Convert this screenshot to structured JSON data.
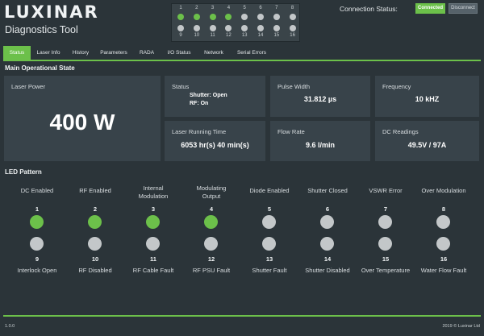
{
  "header": {
    "logo": "LUXINAR",
    "subtitle": "Diagnostics Tool",
    "connection_label": "Connection Status:",
    "connection_status": "Connected",
    "disconnect_label": "Disconnect"
  },
  "mini_leds": [
    {
      "n": "1",
      "state": "on"
    },
    {
      "n": "2",
      "state": "on"
    },
    {
      "n": "3",
      "state": "on"
    },
    {
      "n": "4",
      "state": "on"
    },
    {
      "n": "5",
      "state": "off"
    },
    {
      "n": "6",
      "state": "off"
    },
    {
      "n": "7",
      "state": "off"
    },
    {
      "n": "8",
      "state": "off"
    },
    {
      "n": "9",
      "state": "off"
    },
    {
      "n": "10",
      "state": "off"
    },
    {
      "n": "11",
      "state": "off"
    },
    {
      "n": "12",
      "state": "off"
    },
    {
      "n": "13",
      "state": "off"
    },
    {
      "n": "14",
      "state": "off"
    },
    {
      "n": "15",
      "state": "off"
    },
    {
      "n": "16",
      "state": "off"
    }
  ],
  "tabs": [
    "Status",
    "Laser Info",
    "History",
    "Parameters",
    "RADA",
    "I/O Status",
    "Network",
    "Serial Errors"
  ],
  "active_tab": "Status",
  "main": {
    "title": "Main Operational State",
    "laser_power": {
      "label": "Laser Power",
      "value": "400 W"
    },
    "status": {
      "label": "Status",
      "line1": "Shutter: Open",
      "line2": "RF: On"
    },
    "pulse_width": {
      "label": "Pulse Width",
      "value": "31.812 µs"
    },
    "frequency": {
      "label": "Frequency",
      "value": "10 kHZ"
    },
    "running_time": {
      "label": "Laser Running Time",
      "value": "6053 hr(s) 40 min(s)"
    },
    "flow_rate": {
      "label": "Flow Rate",
      "value": "9.6 l/min"
    },
    "dc_readings": {
      "label": "DC Readings",
      "value": "49.5V / 97A"
    }
  },
  "led_pattern": {
    "title": "LED Pattern",
    "columns": [
      {
        "top": "DC Enabled",
        "n_top": "1",
        "top_state": "on",
        "n_bottom": "9",
        "bottom": "Interlock Open",
        "bottom_state": "off"
      },
      {
        "top": "RF Enabled",
        "n_top": "2",
        "top_state": "on",
        "n_bottom": "10",
        "bottom": "RF Disabled",
        "bottom_state": "off"
      },
      {
        "top": "Internal Modulation",
        "n_top": "3",
        "top_state": "on",
        "n_bottom": "11",
        "bottom": "RF Cable Fault",
        "bottom_state": "off"
      },
      {
        "top": "Modulating Output",
        "n_top": "4",
        "top_state": "on",
        "n_bottom": "12",
        "bottom": "RF PSU Fault",
        "bottom_state": "off"
      },
      {
        "top": "Diode Enabled",
        "n_top": "5",
        "top_state": "off",
        "n_bottom": "13",
        "bottom": "Shutter Fault",
        "bottom_state": "off"
      },
      {
        "top": "Shutter Closed",
        "n_top": "6",
        "top_state": "off",
        "n_bottom": "14",
        "bottom": "Shutter Disabled",
        "bottom_state": "off"
      },
      {
        "top": "VSWR Error",
        "n_top": "7",
        "top_state": "off",
        "n_bottom": "15",
        "bottom": "Over Temperature",
        "bottom_state": "off"
      },
      {
        "top": "Over Modulation",
        "n_top": "8",
        "top_state": "off",
        "n_bottom": "16",
        "bottom": "Water Flow Fault",
        "bottom_state": "off"
      }
    ]
  },
  "footer": {
    "version": "1.0.0",
    "copyright": "2019 © Luxinar Ltd"
  },
  "colors": {
    "accent": "#6cc04a",
    "background": "#2b3439",
    "card": "#38434a",
    "led_off": "#c3c7c9"
  }
}
